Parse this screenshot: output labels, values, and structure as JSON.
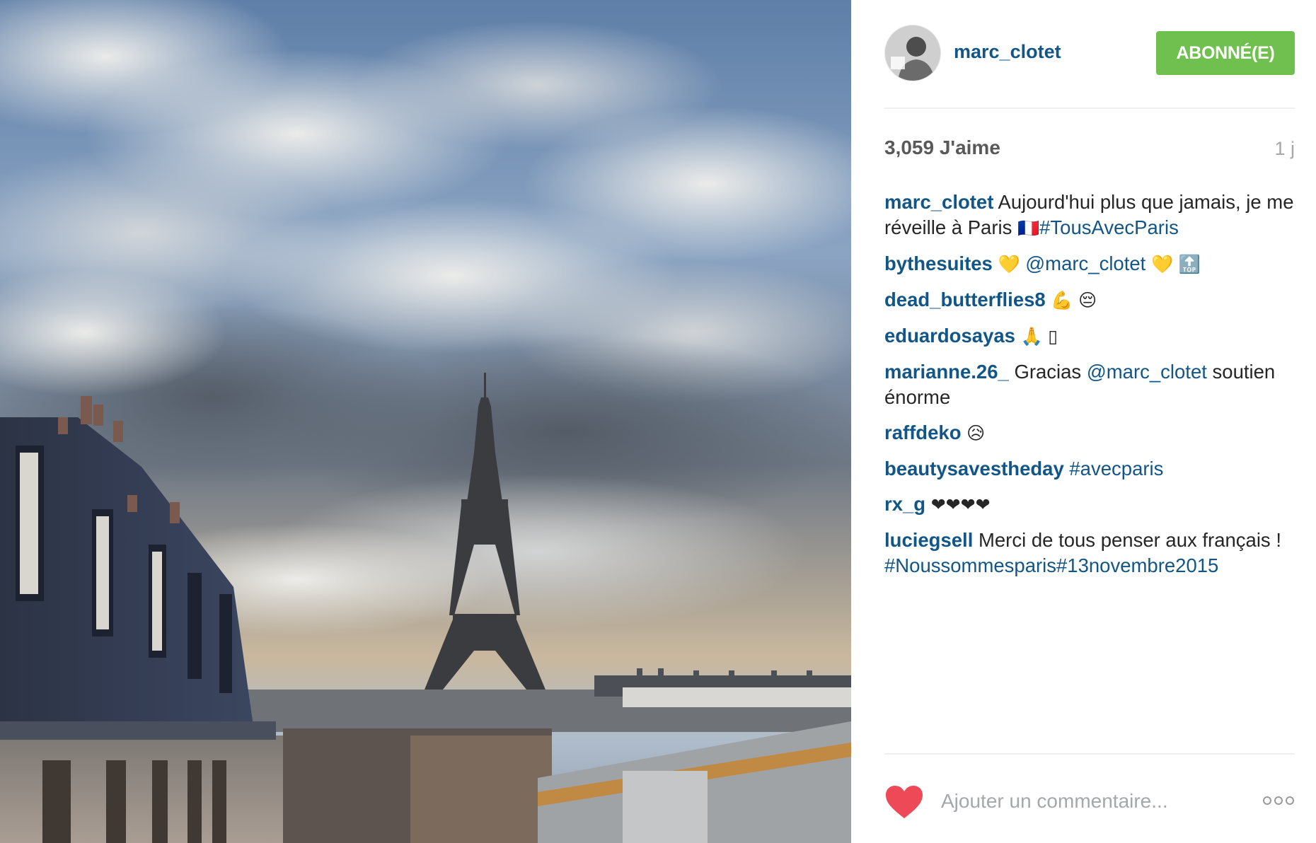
{
  "post": {
    "photo_alt": "",
    "author": {
      "username": "marc_clotet",
      "avatar_icon": "user-avatar"
    },
    "follow_button": {
      "label": "ABONNÉ(E)",
      "color": "#70c050"
    },
    "likes": "3,059 J'aime",
    "age": "1 j",
    "comments": [
      {
        "author": "marc_clotet",
        "parts": [
          {
            "type": "text",
            "value": "Aujourd'hui plus que jamais, je me réveille à Paris "
          },
          {
            "type": "emoji",
            "value": "🇫🇷",
            "icon": "france-flag-icon"
          },
          {
            "type": "link",
            "value": "#TousAvecParis"
          }
        ]
      },
      {
        "author": "bythesuites",
        "parts": [
          {
            "type": "emoji",
            "value": "💛",
            "icon": "yellow-heart-icon"
          },
          {
            "type": "text",
            "value": " "
          },
          {
            "type": "link",
            "value": "@marc_clotet"
          },
          {
            "type": "text",
            "value": " "
          },
          {
            "type": "emoji",
            "value": "💛",
            "icon": "yellow-heart-icon"
          },
          {
            "type": "text",
            "value": " "
          },
          {
            "type": "emoji",
            "value": "🔝",
            "icon": "top-arrow-icon"
          }
        ]
      },
      {
        "author": "dead_butterflies8",
        "parts": [
          {
            "type": "emoji",
            "value": "💪",
            "icon": "flexed-biceps-icon"
          },
          {
            "type": "text",
            "value": " "
          },
          {
            "type": "emoji",
            "value": "😔",
            "icon": "pensive-face-icon"
          }
        ]
      },
      {
        "author": "eduardosayas",
        "parts": [
          {
            "type": "emoji",
            "value": "🙏",
            "icon": "folded-hands-icon"
          },
          {
            "type": "text",
            "value": " "
          },
          {
            "type": "emoji",
            "value": "▯",
            "icon": "missing-glyph-icon"
          }
        ]
      },
      {
        "author": "marianne.26_",
        "parts": [
          {
            "type": "text",
            "value": "Gracias "
          },
          {
            "type": "link",
            "value": "@marc_clotet"
          },
          {
            "type": "text",
            "value": " soutien énorme"
          }
        ]
      },
      {
        "author": "raffdeko",
        "parts": [
          {
            "type": "emoji",
            "value": "😥",
            "icon": "sad-face-icon"
          }
        ]
      },
      {
        "author": "beautysavestheday",
        "parts": [
          {
            "type": "link",
            "value": "#avecparis"
          }
        ]
      },
      {
        "author": "rx_g",
        "parts": [
          {
            "type": "emoji",
            "value": "❤❤❤❤",
            "icon": "black-hearts-icon"
          }
        ]
      },
      {
        "author": "luciegsell",
        "parts": [
          {
            "type": "text",
            "value": "Merci de tous penser aux français ! "
          },
          {
            "type": "link",
            "value": "#Noussommesparis#13novembre2015"
          }
        ]
      }
    ],
    "footer": {
      "like_icon": "heart-icon",
      "heart_color": "#ed4956",
      "comment_placeholder": "Ajouter un commentaire...",
      "more_icon": "more-options-icon"
    },
    "colors": {
      "link": "#125688",
      "muted": "#a5a7aa",
      "divider": "#efefef"
    }
  }
}
